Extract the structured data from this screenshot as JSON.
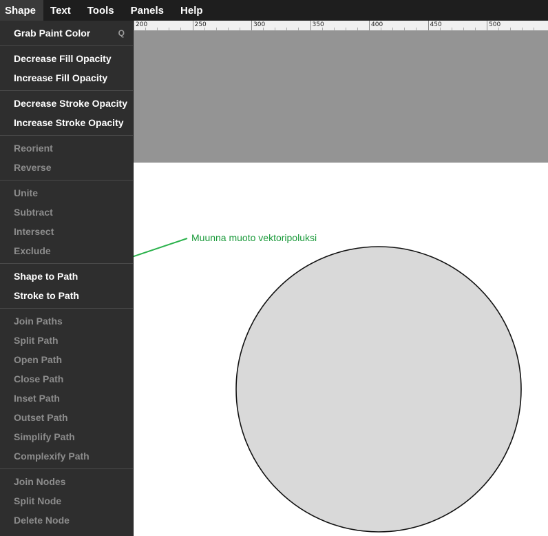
{
  "menubar": {
    "items": [
      {
        "label": "Shape",
        "active": true
      },
      {
        "label": "Text"
      },
      {
        "label": "Tools"
      },
      {
        "label": "Panels"
      },
      {
        "label": "Help"
      }
    ]
  },
  "ruler": {
    "labels": [
      "200",
      "250",
      "300",
      "350",
      "400",
      "450",
      "500"
    ]
  },
  "dropdown": {
    "groups": [
      [
        {
          "label": "Grab Paint Color",
          "shortcut": "Q",
          "enabled": true
        }
      ],
      [
        {
          "label": "Decrease Fill Opacity",
          "enabled": true
        },
        {
          "label": "Increase Fill Opacity",
          "enabled": true
        }
      ],
      [
        {
          "label": "Decrease Stroke Opacity",
          "enabled": true
        },
        {
          "label": "Increase Stroke Opacity",
          "enabled": true
        }
      ],
      [
        {
          "label": "Reorient",
          "enabled": false
        },
        {
          "label": "Reverse",
          "enabled": false
        }
      ],
      [
        {
          "label": "Unite",
          "enabled": false
        },
        {
          "label": "Subtract",
          "enabled": false
        },
        {
          "label": "Intersect",
          "enabled": false
        },
        {
          "label": "Exclude",
          "enabled": false
        }
      ],
      [
        {
          "label": "Shape to Path",
          "enabled": true
        },
        {
          "label": "Stroke to Path",
          "enabled": true
        }
      ],
      [
        {
          "label": "Join Paths",
          "enabled": false
        },
        {
          "label": "Split Path",
          "enabled": false
        },
        {
          "label": "Open Path",
          "enabled": false
        },
        {
          "label": "Close Path",
          "enabled": false
        },
        {
          "label": "Inset Path",
          "enabled": false
        },
        {
          "label": "Outset Path",
          "enabled": false
        },
        {
          "label": "Simplify Path",
          "enabled": false
        },
        {
          "label": "Complexify Path",
          "enabled": false
        }
      ],
      [
        {
          "label": "Join Nodes",
          "enabled": false
        },
        {
          "label": "Split Node",
          "enabled": false
        },
        {
          "label": "Delete Node",
          "enabled": false
        }
      ]
    ]
  },
  "annotation": {
    "text": "Muunna muoto vektoripoluksi",
    "color": "#1a9a3a"
  },
  "colors": {
    "menubar_bg": "#1e1e1e",
    "menu_bg": "#2e2e2e",
    "canvas_gray": "#949494",
    "circle_fill": "#d9d9d9"
  }
}
